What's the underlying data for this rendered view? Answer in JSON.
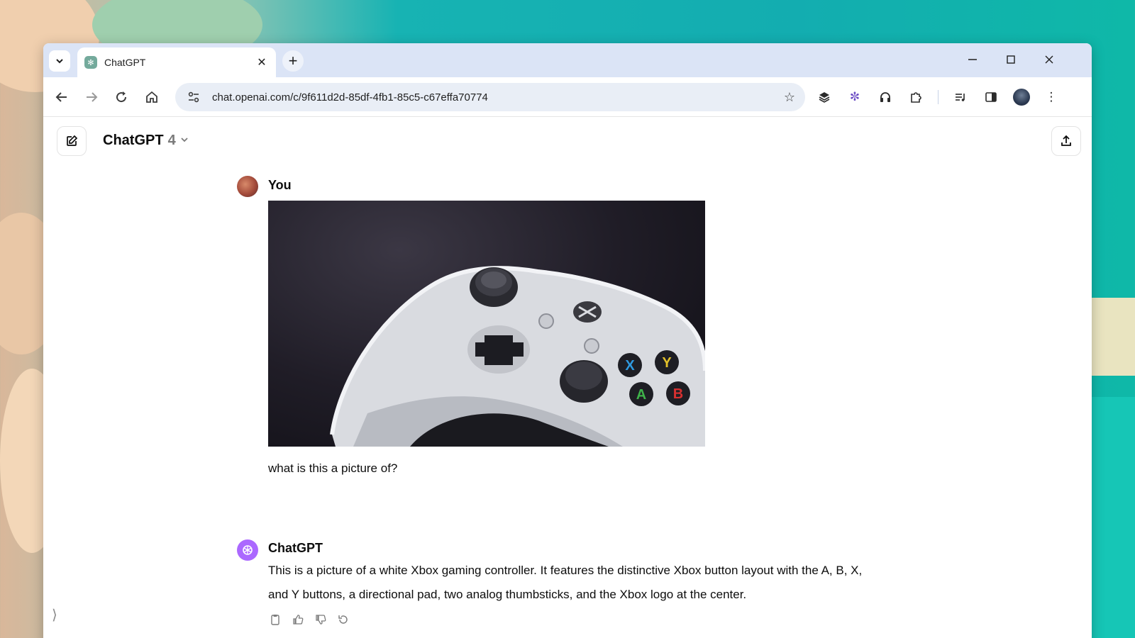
{
  "browser": {
    "tab_title": "ChatGPT",
    "url": "chat.openai.com/c/9f611d2d-85df-4fb1-85c5-c67effa70774",
    "icons": {
      "tab_search": "chevron-down-icon",
      "close_tab": "close-icon",
      "new_tab": "plus-icon",
      "minimize": "minimize-icon",
      "maximize": "maximize-icon",
      "close_window": "close-icon",
      "back": "back-arrow-icon",
      "forward": "forward-arrow-icon",
      "reload": "reload-icon",
      "home": "home-icon",
      "site_info": "tune-icon",
      "bookmark": "star-icon",
      "extensions": [
        "layers-icon",
        "asterisk-icon",
        "headphones-icon",
        "puzzle-icon",
        "media-icon",
        "side-panel-icon",
        "profile-avatar",
        "kebab-menu-icon"
      ]
    }
  },
  "chat": {
    "model_name": "ChatGPT",
    "model_version": "4",
    "messages": [
      {
        "author": "You",
        "image": "white-xbox-controller-photo",
        "text": "what is this a picture of?"
      },
      {
        "author": "ChatGPT",
        "text": "This is a picture of a white Xbox gaming controller. It features the distinctive Xbox button layout with the A, B, X, and Y buttons, a directional pad, two analog thumbsticks, and the Xbox logo at the center."
      }
    ],
    "response_actions": [
      "copy-icon",
      "thumbs-up-icon",
      "thumbs-down-icon",
      "regenerate-icon"
    ]
  },
  "colors": {
    "tabstrip_bg": "#dbe4f6",
    "omnibox_bg": "#e9eef6",
    "gpt_avatar": "#ab68ff",
    "text": "#0d0d0d"
  }
}
